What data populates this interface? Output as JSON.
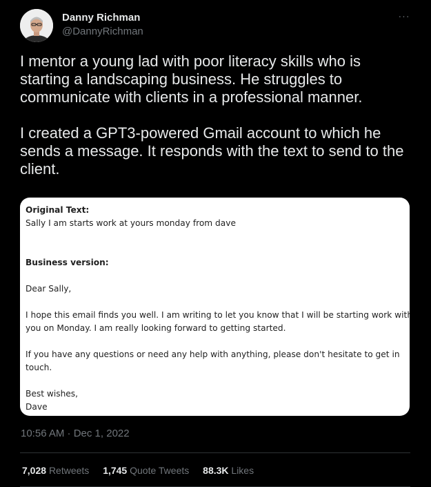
{
  "author": {
    "name": "Danny Richman",
    "handle": "@DannyRichman"
  },
  "menu": {
    "icon": "more-horizontal-icon",
    "glyph": "···"
  },
  "tweet": {
    "paragraphs": [
      "I mentor a young lad with poor literacy skills who is starting a landscaping business. He struggles to communicate with clients in a professional manner.",
      "I created a GPT3-powered Gmail account to which he sends a message. It responds with the text to send to the client."
    ]
  },
  "media": {
    "original_heading": "Original Text:",
    "original_text": "Sally I am starts work at yours monday from dave",
    "business_heading": "Business version:",
    "greeting": "Dear Sally,",
    "body_1_line_1": "I hope this email finds you well. I am writing to let you know that I will be starting work with",
    "body_1_line_2": "you on Monday. I am really looking forward to getting started.",
    "body_2_line_1": "If you have any questions or need any help with anything, please don't hesitate to get in",
    "body_2_line_2": "touch.",
    "signoff": "Best wishes,",
    "signature": "Dave"
  },
  "meta": {
    "timestamp": "10:56 AM · Dec 1, 2022"
  },
  "stats": {
    "retweets_count": "7,028",
    "retweets_label": "Retweets",
    "quotes_count": "1,745",
    "quotes_label": "Quote Tweets",
    "likes_count": "88.3K",
    "likes_label": "Likes"
  },
  "colors": {
    "background": "#000000",
    "text_primary": "#e7e9ea",
    "text_secondary": "#71767b",
    "divider": "#2f3336"
  }
}
